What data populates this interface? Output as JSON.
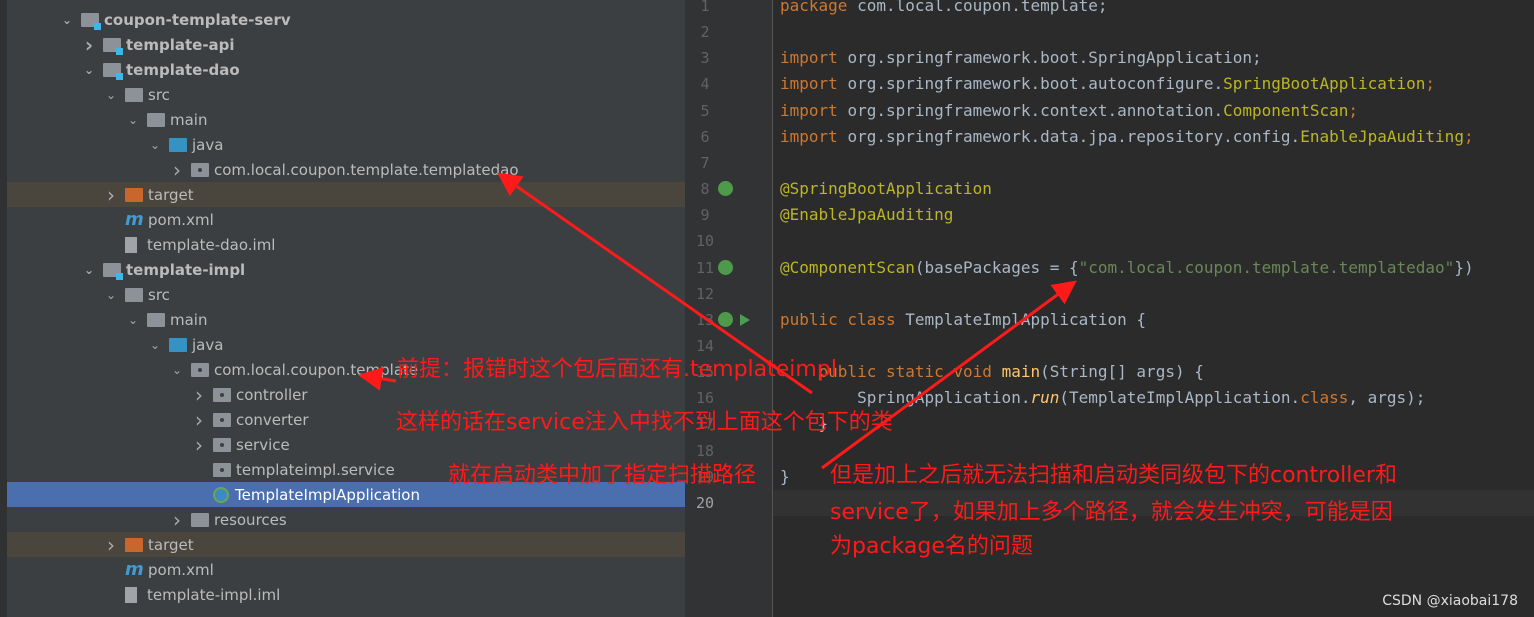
{
  "tree": [
    {
      "label": "coupon-template-serv",
      "chevron": "down",
      "icon": "module-folder-icon",
      "indent": 0,
      "bold": true
    },
    {
      "label": "template-api",
      "chevron": "right",
      "icon": "module-folder-icon",
      "indent": 1,
      "bold": true
    },
    {
      "label": "template-dao",
      "chevron": "down",
      "icon": "module-folder-icon",
      "indent": 1,
      "bold": true
    },
    {
      "label": "src",
      "chevron": "down",
      "icon": "folder-icon",
      "indent": 2
    },
    {
      "label": "main",
      "chevron": "down",
      "icon": "folder-icon",
      "indent": 3
    },
    {
      "label": "java",
      "chevron": "down",
      "icon": "java-folder-icon",
      "indent": 4
    },
    {
      "label": "com.local.coupon.template.templatedao",
      "chevron": "right",
      "icon": "package-icon",
      "indent": 5
    },
    {
      "label": "target",
      "chevron": "right",
      "icon": "target-folder-icon",
      "indent": 2,
      "excluded": true
    },
    {
      "label": "pom.xml",
      "chevron": "",
      "icon": "maven-icon",
      "indent": 2
    },
    {
      "label": "template-dao.iml",
      "chevron": "",
      "icon": "iml-file-icon",
      "indent": 2
    },
    {
      "label": "template-impl",
      "chevron": "down",
      "icon": "module-folder-icon",
      "indent": 1,
      "bold": true
    },
    {
      "label": "src",
      "chevron": "down",
      "icon": "folder-icon",
      "indent": 2
    },
    {
      "label": "main",
      "chevron": "down",
      "icon": "folder-icon",
      "indent": 3
    },
    {
      "label": "java",
      "chevron": "down",
      "icon": "java-folder-icon",
      "indent": 4
    },
    {
      "label": "com.local.coupon.template",
      "chevron": "down",
      "icon": "package-icon",
      "indent": 5
    },
    {
      "label": "controller",
      "chevron": "right",
      "icon": "package-icon",
      "indent": 6
    },
    {
      "label": "converter",
      "chevron": "right",
      "icon": "package-icon",
      "indent": 6
    },
    {
      "label": "service",
      "chevron": "right",
      "icon": "package-icon",
      "indent": 6
    },
    {
      "label": "templateimpl.service",
      "chevron": "",
      "icon": "package-icon",
      "indent": 6
    },
    {
      "label": "TemplateImplApplication",
      "chevron": "",
      "icon": "spring-class-icon",
      "indent": 6,
      "selected": true
    },
    {
      "label": "resources",
      "chevron": "right",
      "icon": "resources-folder-icon",
      "indent": 5
    },
    {
      "label": "target",
      "chevron": "right",
      "icon": "target-folder-icon",
      "indent": 2,
      "excluded": true
    },
    {
      "label": "pom.xml",
      "chevron": "",
      "icon": "maven-icon",
      "indent": 2
    },
    {
      "label": "template-impl.iml",
      "chevron": "",
      "icon": "iml-file-icon",
      "indent": 2
    }
  ],
  "code": [
    [
      [
        "kw",
        "package "
      ],
      [
        "",
        "com.local.coupon.template;"
      ]
    ],
    [],
    [
      [
        "kw",
        "import "
      ],
      [
        "",
        "org.springframework.boot.SpringApplication;"
      ]
    ],
    [
      [
        "kw",
        "import "
      ],
      [
        "",
        "org.springframework.boot.autoconfigure."
      ],
      [
        "ann",
        "SpringBootApplication"
      ],
      [
        "kw",
        ";"
      ]
    ],
    [
      [
        "kw",
        "import "
      ],
      [
        "",
        "org.springframework.context.annotation."
      ],
      [
        "ann",
        "ComponentScan"
      ],
      [
        "kw",
        ";"
      ]
    ],
    [
      [
        "kw",
        "import "
      ],
      [
        "",
        "org.springframework.data.jpa.repository.config."
      ],
      [
        "ann",
        "EnableJpaAuditing"
      ],
      [
        "kw",
        ";"
      ]
    ],
    [],
    [
      [
        "ann",
        "@SpringBootApplication"
      ]
    ],
    [
      [
        "ann",
        "@EnableJpaAuditing"
      ]
    ],
    [],
    [
      [
        "ann",
        "@ComponentScan"
      ],
      [
        "",
        "(basePackages = {"
      ],
      [
        "str",
        "\"com.local.coupon.template.templatedao\""
      ],
      [
        "",
        "})"
      ]
    ],
    [],
    [
      [
        "kw",
        "public class "
      ],
      [
        "",
        "TemplateImplApplication {"
      ]
    ],
    [],
    [
      [
        "kw",
        "    public static void "
      ],
      [
        "fn",
        "main"
      ],
      [
        "",
        "(String[] args) {"
      ]
    ],
    [
      [
        "",
        "        SpringApplication."
      ],
      [
        "fn it",
        "run"
      ],
      [
        "",
        "(TemplateImplApplication."
      ],
      [
        "kw",
        "class"
      ],
      [
        "",
        ", args);"
      ]
    ],
    [
      [
        "",
        "    }"
      ]
    ],
    [],
    [
      [
        "",
        "}"
      ]
    ],
    []
  ],
  "current_line": 20,
  "notes": {
    "premise": "前提：报错时这个包后面还有.templateimpl",
    "consequence": "这样的话在service注入中找不到上面这个包下的类",
    "action": "就在启动类中加了指定扫描路径",
    "problem_1": "但是加上之后就无法扫描和启动类同级包下的controller和",
    "problem_2": "service了，如果加上多个路径，就会发生冲突，可能是因",
    "problem_3": "为package名的问题"
  },
  "watermark": "CSDN @xiaobai178",
  "colors": {
    "annotation_red": "#ff1a1a",
    "selection": "#4b6eaf",
    "keyword": "#cc7832",
    "annotation": "#bbb529",
    "string": "#6a8759"
  }
}
